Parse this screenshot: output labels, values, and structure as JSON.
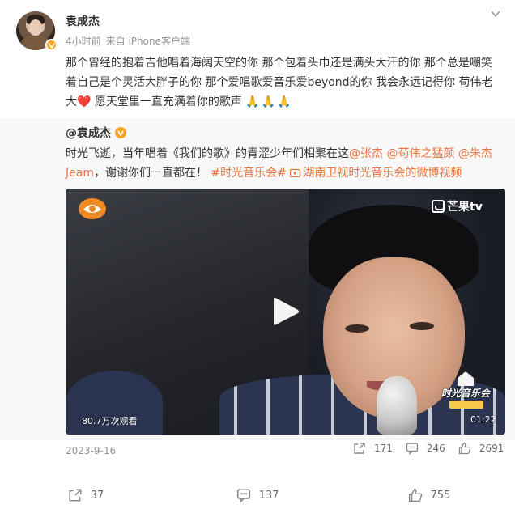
{
  "post": {
    "author": "袁成杰",
    "time": "4小时前",
    "source": "来自 iPhone客户端",
    "text_before_heart": "那个曾经的抱着吉他唱着海阔天空的你 那个包着头巾还是满头大汗的你 那个总是嘲笑着自己是个灵活大胖子的你 那个爱唱歌爱音乐爱beyond的你 我会永远记得你 苟伟老大",
    "heart": "❤️",
    "text_after_heart": " 愿天堂里一直充满着你的歌声",
    "pray": "🙏🙏🙏"
  },
  "repost": {
    "author": "@袁成杰",
    "text_intro": "时光飞逝，当年唱着《我们的歌》的青涩少年们相聚在这",
    "mentions": [
      "@张杰",
      "@苟伟之猛颜",
      "@朱杰Jeam"
    ],
    "text_after_mentions": "，谢谢你们一直都在！",
    "topic": "#时光音乐会#",
    "video_link": "湖南卫视时光音乐会的微博视频",
    "video": {
      "watermark": "芒果tv",
      "show_logo": "时光音乐会",
      "views": "80.7万次观看",
      "duration": "01:22"
    },
    "date": "2023-9-16",
    "stats": {
      "reposts": "171",
      "comments": "246",
      "likes": "2691"
    }
  },
  "footer": {
    "reposts": "37",
    "comments": "137",
    "likes": "755"
  },
  "colors": {
    "link": "#eb7340",
    "verified": "#f5a623",
    "meta": "#939393"
  }
}
